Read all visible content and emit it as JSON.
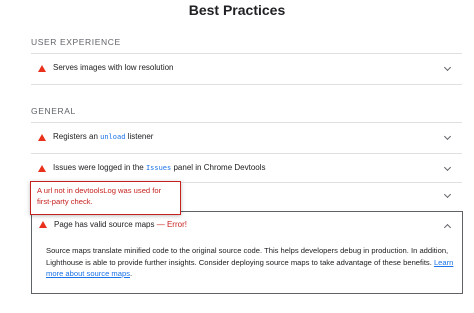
{
  "page": {
    "title": "Best Practices"
  },
  "sections": [
    {
      "label": "USER EXPERIENCE"
    },
    {
      "label": "GENERAL"
    }
  ],
  "audits": {
    "low_resolution": {
      "label": "Serves images with low resolution"
    },
    "unload_listener": {
      "label_prefix": "Registers an ",
      "code": "unload",
      "label_suffix": " listener"
    },
    "issues_logged": {
      "label_prefix": "Issues were logged in the ",
      "code": "Issues",
      "label_suffix": " panel in Chrome Devtools"
    },
    "source_maps": {
      "label": "Page has valid source maps",
      "separator": " — ",
      "error": "Error!",
      "description": "Source maps translate minified code to the original source code. This helps developers debug in production. In addition, Lighthouse is able to provide further insights. Consider deploying source maps to take advantage of these benefits. ",
      "link_text": "Learn more about source maps"
    }
  },
  "tooltip": {
    "text": "A url not in devtoolsLog was used for first-party check."
  },
  "colors": {
    "warning": "#e8301b",
    "error": "#c5221f",
    "link": "#1a73e8"
  },
  "icons": {
    "warning": "warning-triangle-icon",
    "expand": "chevron-down-icon",
    "collapse": "chevron-up-icon"
  }
}
